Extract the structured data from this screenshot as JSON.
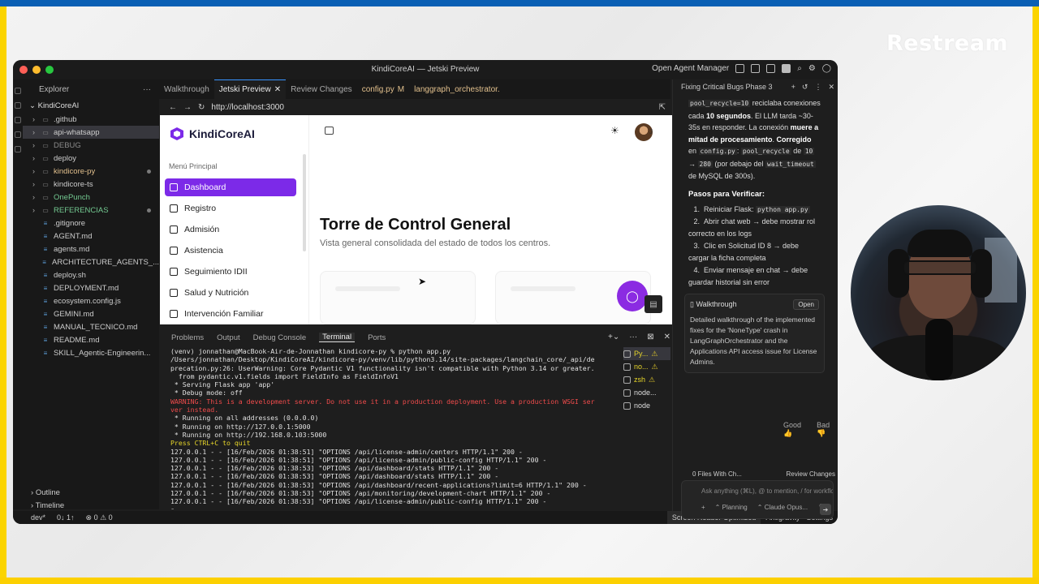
{
  "watermark": "Restream",
  "window": {
    "title": "KindiCoreAI — Jetski Preview",
    "right_label": "Open Agent Manager"
  },
  "explorer": {
    "title": "Explorer",
    "root": "KindiCoreAI",
    "items": [
      {
        "label": ".github",
        "type": "folder",
        "color": "#cccccc"
      },
      {
        "label": "api-whatsapp",
        "type": "folder",
        "color": "#cccccc"
      },
      {
        "label": "DEBUG",
        "type": "folder",
        "color": "#8a8a8a"
      },
      {
        "label": "deploy",
        "type": "folder",
        "color": "#cccccc"
      },
      {
        "label": "kindicore-py",
        "type": "folder",
        "color": "#e2c08d"
      },
      {
        "label": "kindicore-ts",
        "type": "folder",
        "color": "#cccccc"
      },
      {
        "label": "OnePunch",
        "type": "folder",
        "color": "#73c991"
      },
      {
        "label": "REFERENCIAS",
        "type": "folder",
        "color": "#73c991"
      },
      {
        "label": ".gitignore",
        "type": "file",
        "color": "#cccccc"
      },
      {
        "label": "AGENT.md",
        "type": "file",
        "color": "#cccccc"
      },
      {
        "label": "agents.md",
        "type": "file",
        "color": "#cccccc"
      },
      {
        "label": "ARCHITECTURE_AGENTS_...",
        "type": "file",
        "color": "#cccccc"
      },
      {
        "label": "deploy.sh",
        "type": "file",
        "color": "#cccccc"
      },
      {
        "label": "DEPLOYMENT.md",
        "type": "file",
        "color": "#cccccc"
      },
      {
        "label": "ecosystem.config.js",
        "type": "file",
        "color": "#cccccc"
      },
      {
        "label": "GEMINI.md",
        "type": "file",
        "color": "#cccccc"
      },
      {
        "label": "MANUAL_TECNICO.md",
        "type": "file",
        "color": "#cccccc"
      },
      {
        "label": "README.md",
        "type": "file",
        "color": "#cccccc"
      },
      {
        "label": "SKILL_Agentic-Engineerin...",
        "type": "file",
        "color": "#cccccc"
      }
    ],
    "outline": "Outline",
    "timeline": "Timeline"
  },
  "tabs": [
    {
      "label": "Walkthrough",
      "active": false
    },
    {
      "label": "Jetski Preview",
      "active": true
    },
    {
      "label": "Review Changes",
      "active": false
    },
    {
      "label": "config.py",
      "badge": "M",
      "active": false
    },
    {
      "label": "langgraph_orchestrator.",
      "active": false
    }
  ],
  "browser": {
    "url": "http://localhost:3000",
    "app_name": "KindiCoreAI",
    "menu_label": "Menú Principal",
    "nav": [
      "Dashboard",
      "Registro",
      "Admisión",
      "Asistencia",
      "Seguimiento IDII",
      "Salud y Nutrición",
      "Intervención Familiar"
    ],
    "avatar_initial": "J",
    "page_title": "Torre de Control General",
    "page_subtitle": "Vista general consolidada del estado de todos los centros."
  },
  "panel": {
    "tabs": [
      "Problems",
      "Output",
      "Debug Console",
      "Terminal",
      "Ports"
    ],
    "active": "Terminal"
  },
  "terminal": {
    "lines": [
      {
        "text": "(venv) jonnathan@MacBook-Air-de-Jonnathan kindicore-py % python app.py",
        "kind": "normal"
      },
      {
        "text": "/Users/jonnathan/Desktop/KindiCoreAI/kindicore-py/venv/lib/python3.14/site-packages/langchain_core/_api/de",
        "kind": "normal"
      },
      {
        "text": "precation.py:26: UserWarning: Core Pydantic V1 functionality isn't compatible with Python 3.14 or greater.",
        "kind": "normal"
      },
      {
        "text": "  from pydantic.v1.fields import FieldInfo as FieldInfoV1",
        "kind": "normal"
      },
      {
        "text": " * Serving Flask app 'app'",
        "kind": "normal"
      },
      {
        "text": " * Debug mode: off",
        "kind": "normal"
      },
      {
        "text": "WARNING: This is a development server. Do not use it in a production deployment. Use a production WSGI ser",
        "kind": "warn"
      },
      {
        "text": "ver instead.",
        "kind": "warn"
      },
      {
        "text": " * Running on all addresses (0.0.0.0)",
        "kind": "normal"
      },
      {
        "text": " * Running on http://127.0.0.1:5000",
        "kind": "normal"
      },
      {
        "text": " * Running on http://192.168.0.103:5000",
        "kind": "normal"
      },
      {
        "text": "Press CTRL+C to quit",
        "kind": "yellow"
      },
      {
        "text": "127.0.0.1 - - [16/Feb/2026 01:38:51] \"OPTIONS /api/license-admin/centers HTTP/1.1\" 200 -",
        "kind": "normal"
      },
      {
        "text": "127.0.0.1 - - [16/Feb/2026 01:38:51] \"OPTIONS /api/license-admin/public-config HTTP/1.1\" 200 -",
        "kind": "normal"
      },
      {
        "text": "127.0.0.1 - - [16/Feb/2026 01:38:53] \"OPTIONS /api/dashboard/stats HTTP/1.1\" 200 -",
        "kind": "normal"
      },
      {
        "text": "127.0.0.1 - - [16/Feb/2026 01:38:53] \"OPTIONS /api/dashboard/stats HTTP/1.1\" 200 -",
        "kind": "normal"
      },
      {
        "text": "127.0.0.1 - - [16/Feb/2026 01:38:53] \"OPTIONS /api/dashboard/recent-applications?limit=6 HTTP/1.1\" 200 -",
        "kind": "normal"
      },
      {
        "text": "127.0.0.1 - - [16/Feb/2026 01:38:53] \"OPTIONS /api/monitoring/development-chart HTTP/1.1\" 200 -",
        "kind": "normal"
      },
      {
        "text": "127.0.0.1 - - [16/Feb/2026 01:38:53] \"OPTIONS /api/license-admin/public-config HTTP/1.1\" 200 -",
        "kind": "normal"
      }
    ],
    "sessions": [
      {
        "label": "Py...",
        "warn": true,
        "active": true
      },
      {
        "label": "no...",
        "warn": true,
        "active": false
      },
      {
        "label": "zsh",
        "warn": true,
        "active": false
      },
      {
        "label": "node...",
        "warn": false,
        "active": false
      },
      {
        "label": "node",
        "warn": false,
        "active": false
      }
    ]
  },
  "statusbar": {
    "branch": "dev*",
    "sync": "0↓ 1↑",
    "problems": "⊗ 0 ⚠ 0",
    "screen_reader": "Screen Reader Optimized",
    "settings": "Antigravity - Settings"
  },
  "agent": {
    "title": "Fixing Critical Bugs Phase 3",
    "para_html_parts": {
      "code1": "pool_recycle=10",
      "t1": " reciclaba conexiones cada ",
      "b1": "10 segundos",
      "t2": ". El LLM tarda ~30-35s en responder. La conexión ",
      "b2": "muere a mitad de procesamiento",
      "t3": ". ",
      "b3": "Corregido",
      "t4": " en ",
      "code2": "config.py",
      "t5": ": ",
      "code3": "pool_recycle",
      "t6": " de ",
      "code4": "10",
      "t7": " → ",
      "code5": "280",
      "t8": " (por debajo del ",
      "code6": "wait_timeout",
      "t9": " de MySQL de 300s)."
    },
    "verify_heading": "Pasos para Verificar:",
    "steps": [
      {
        "n": "1.",
        "text": "Reiniciar Flask: ",
        "code": "python app.py"
      },
      {
        "n": "2.",
        "text": "Abrir chat web → debe mostrar rol correcto en los logs",
        "code": ""
      },
      {
        "n": "3.",
        "text": "Clic en Solicitud ID 8 → debe cargar la ficha completa",
        "code": ""
      },
      {
        "n": "4.",
        "text": "Enviar mensaje en chat → debe guardar historial sin error",
        "code": ""
      }
    ],
    "walkthrough": {
      "title": "Walkthrough",
      "open": "Open",
      "desc": "Detailed walkthrough of the implemented fixes for the 'NoneType' crash in LangGraphOrchestrator and the Applications API access issue for License Admins."
    },
    "good": "Good",
    "bad": "Bad",
    "files": "0 Files With Ch...",
    "review": "Review Changes",
    "ask_placeholder": "Ask anything (⌘L), @ to mention, / for workflo",
    "mode": "Planning",
    "model": "Claude Opus..."
  }
}
